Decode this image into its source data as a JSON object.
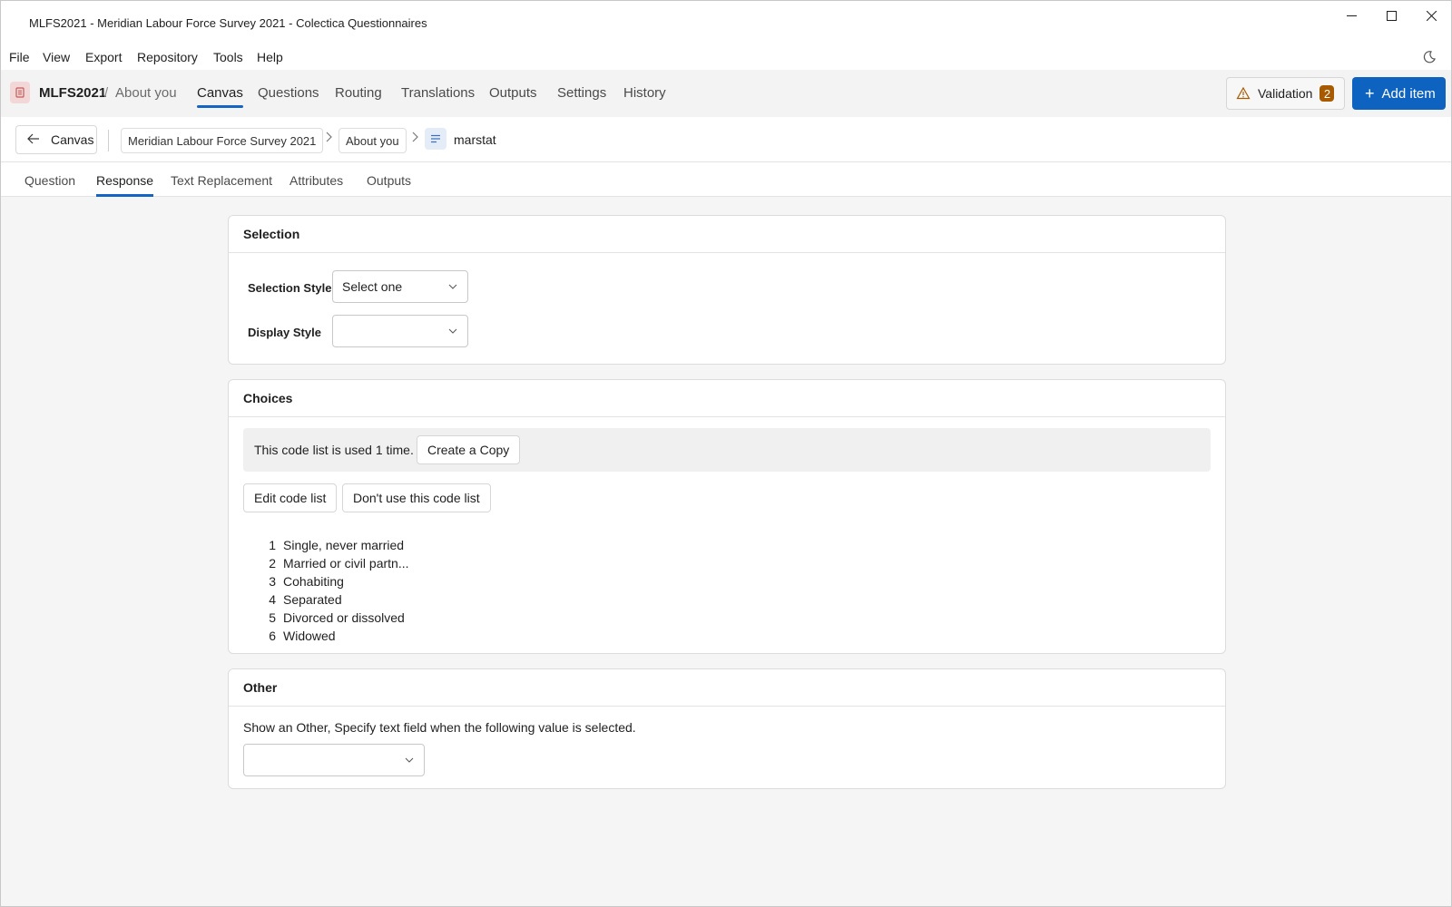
{
  "window": {
    "title": "MLFS2021 - Meridian Labour Force Survey 2021 - Colectica Questionnaires"
  },
  "menu": [
    "File",
    "View",
    "Export",
    "Repository",
    "Tools",
    "Help"
  ],
  "app": {
    "name": "MLFS2021",
    "separator": "/",
    "section": "About you"
  },
  "top_tabs": [
    "Canvas",
    "Questions",
    "Routing",
    "Translations",
    "Outputs",
    "Settings",
    "History"
  ],
  "active_top_tab": "Canvas",
  "validation": {
    "label": "Validation",
    "count": "2"
  },
  "add_item": {
    "label": "Add item",
    "icon": "plus-icon"
  },
  "breadcrumb": {
    "back_label": "Canvas",
    "items": [
      "Meridian Labour Force Survey 2021",
      "About you"
    ],
    "current": "marstat"
  },
  "sub_tabs": [
    "Question",
    "Response",
    "Text Replacement",
    "Attributes",
    "Outputs"
  ],
  "active_sub_tab": "Response",
  "selection": {
    "header": "Selection",
    "style_label": "Selection Style",
    "style_value": "Select one",
    "display_label": "Display Style",
    "display_value": ""
  },
  "choices": {
    "header": "Choices",
    "usage_text": "This code list is used 1 time.",
    "copy_button": "Create a Copy",
    "edit_button": "Edit code list",
    "dont_use_button": "Don't use this code list",
    "codes": [
      {
        "num": "1",
        "label": "Single, never married"
      },
      {
        "num": "2",
        "label": "Married or civil partn..."
      },
      {
        "num": "3",
        "label": "Cohabiting"
      },
      {
        "num": "4",
        "label": "Separated"
      },
      {
        "num": "5",
        "label": "Divorced or dissolved"
      },
      {
        "num": "6",
        "label": "Widowed"
      }
    ]
  },
  "other": {
    "header": "Other",
    "description": "Show an Other, Specify text field when the following value is selected.",
    "value": ""
  },
  "colors": {
    "accent": "#0f63c0",
    "badge": "#a85a00",
    "tab_underline": "#1464c4"
  }
}
